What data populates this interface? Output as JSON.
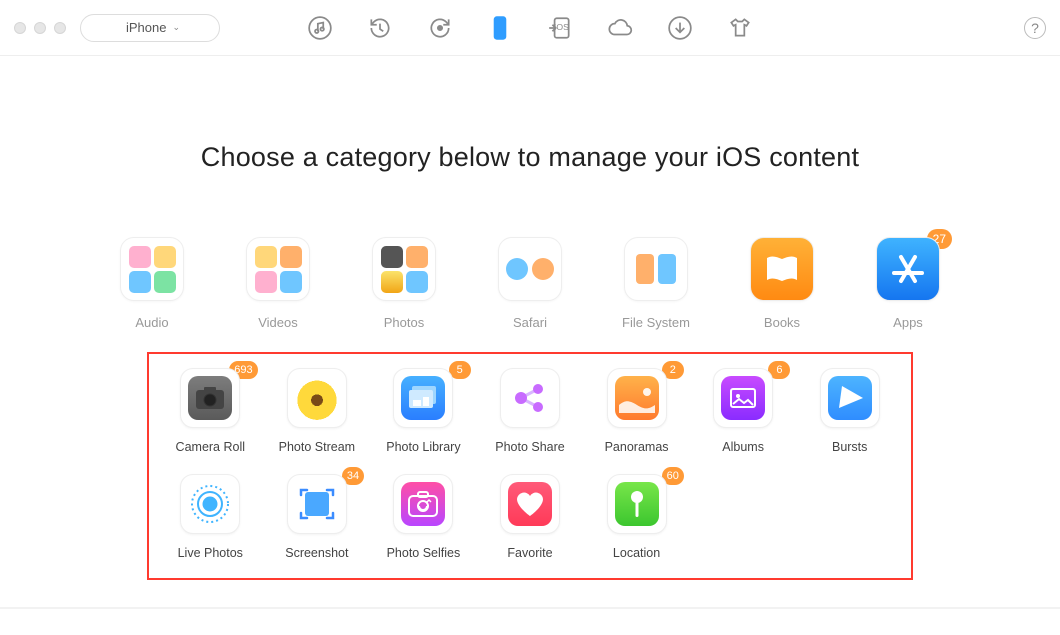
{
  "device": {
    "label": "iPhone"
  },
  "heading": "Choose a category below to manage your iOS content",
  "toolbar": {
    "items": [
      "music",
      "history",
      "wifi-transfer",
      "phone",
      "to-ios",
      "cloud",
      "download",
      "tshirt"
    ]
  },
  "categories": [
    {
      "key": "audio",
      "label": "Audio",
      "badge": null
    },
    {
      "key": "videos",
      "label": "Videos",
      "badge": null
    },
    {
      "key": "photos",
      "label": "Photos",
      "badge": null
    },
    {
      "key": "safari",
      "label": "Safari",
      "badge": null
    },
    {
      "key": "filesystem",
      "label": "File System",
      "badge": null
    },
    {
      "key": "books",
      "label": "Books",
      "badge": null
    },
    {
      "key": "apps",
      "label": "Apps",
      "badge": "27"
    }
  ],
  "sub": [
    {
      "key": "camera-roll",
      "label": "Camera Roll",
      "badge": "693"
    },
    {
      "key": "photo-stream",
      "label": "Photo Stream",
      "badge": null
    },
    {
      "key": "photo-library",
      "label": "Photo Library",
      "badge": "5"
    },
    {
      "key": "photo-share",
      "label": "Photo Share",
      "badge": null
    },
    {
      "key": "panoramas",
      "label": "Panoramas",
      "badge": "2"
    },
    {
      "key": "albums",
      "label": "Albums",
      "badge": "6"
    },
    {
      "key": "bursts",
      "label": "Bursts",
      "badge": null
    },
    {
      "key": "live-photos",
      "label": "Live Photos",
      "badge": null
    },
    {
      "key": "screenshot",
      "label": "Screenshot",
      "badge": "34"
    },
    {
      "key": "photo-selfies",
      "label": "Photo Selfies",
      "badge": null
    },
    {
      "key": "favorite",
      "label": "Favorite",
      "badge": null
    },
    {
      "key": "location",
      "label": "Location",
      "badge": "60"
    }
  ],
  "help": "?"
}
